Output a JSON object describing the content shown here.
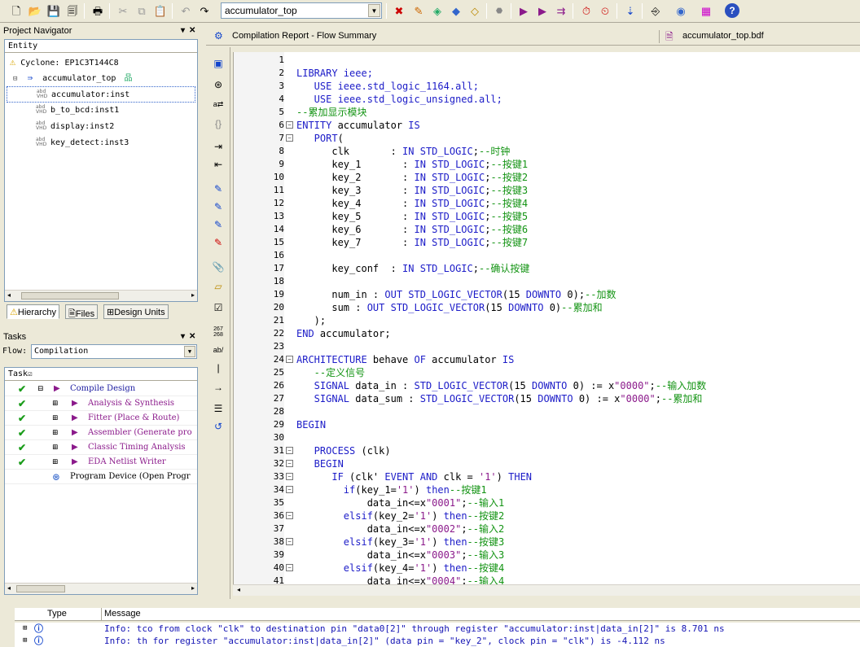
{
  "toolbar": {
    "project_combo": "accumulator_top"
  },
  "project_navigator": {
    "title": "Project Navigator",
    "column": "Entity",
    "device": "Cyclone: EP1C3T144C8",
    "top_entity": "accumulator_top",
    "instances": [
      "accumulator:inst",
      "b_to_bcd:inst1",
      "display:inst2",
      "key_detect:inst3"
    ],
    "tabs": [
      "Hierarchy",
      "Files",
      "Design Units"
    ]
  },
  "tasks": {
    "title": "Tasks",
    "flow_label": "Flow:",
    "flow_value": "Compilation",
    "column": "Task",
    "items": [
      "Compile Design",
      "Analysis & Synthesis",
      "Fitter (Place & Route)",
      "Assembler (Generate pro",
      "Classic Timing Analysis",
      "EDA Netlist Writer",
      "Program Device (Open Progr"
    ]
  },
  "editor_tabs": {
    "left": "Compilation Report - Flow Summary",
    "right": "accumulator_top.bdf"
  },
  "code_lines": [
    [
      [
        "",
        ""
      ]
    ],
    [
      [
        "kw",
        "LIBRARY ieee;"
      ]
    ],
    [
      [
        "kw",
        "   USE ieee.std_logic_1164.all;"
      ]
    ],
    [
      [
        "kw",
        "   USE ieee.std_logic_unsigned.all;"
      ]
    ],
    [
      [
        "cm",
        "--累加显示模块"
      ]
    ],
    [
      [
        "kw",
        "ENTITY"
      ],
      [
        "",
        "accumulator"
      ],
      [
        "kw",
        "IS"
      ]
    ],
    [
      [
        "kw",
        "   PORT"
      ],
      [
        "",
        "("
      ]
    ],
    [
      [
        "",
        "      clk       : "
      ],
      [
        "kw",
        "IN STD_LOGIC"
      ],
      [
        "",
        ";"
      ],
      [
        "cm",
        "--时钟"
      ]
    ],
    [
      [
        "",
        "      key_1       : "
      ],
      [
        "kw",
        "IN STD_LOGIC"
      ],
      [
        "",
        ";"
      ],
      [
        "cm",
        "--按键1"
      ]
    ],
    [
      [
        "",
        "      key_2       : "
      ],
      [
        "kw",
        "IN STD_LOGIC"
      ],
      [
        "",
        ";"
      ],
      [
        "cm",
        "--按键2"
      ]
    ],
    [
      [
        "",
        "      key_3       : "
      ],
      [
        "kw",
        "IN STD_LOGIC"
      ],
      [
        "",
        ";"
      ],
      [
        "cm",
        "--按键3"
      ]
    ],
    [
      [
        "",
        "      key_4       : "
      ],
      [
        "kw",
        "IN STD_LOGIC"
      ],
      [
        "",
        ";"
      ],
      [
        "cm",
        "--按键4"
      ]
    ],
    [
      [
        "",
        "      key_5       : "
      ],
      [
        "kw",
        "IN STD_LOGIC"
      ],
      [
        "",
        ";"
      ],
      [
        "cm",
        "--按键5"
      ]
    ],
    [
      [
        "",
        "      key_6       : "
      ],
      [
        "kw",
        "IN STD_LOGIC"
      ],
      [
        "",
        ";"
      ],
      [
        "cm",
        "--按键6"
      ]
    ],
    [
      [
        "",
        "      key_7       : "
      ],
      [
        "kw",
        "IN STD_LOGIC"
      ],
      [
        "",
        ";"
      ],
      [
        "cm",
        "--按键7"
      ]
    ],
    [
      [
        "",
        ""
      ]
    ],
    [
      [
        "",
        "      key_conf  : "
      ],
      [
        "kw",
        "IN STD_LOGIC"
      ],
      [
        "",
        ";"
      ],
      [
        "cm",
        "--确认按键"
      ]
    ],
    [
      [
        "",
        ""
      ]
    ],
    [
      [
        "",
        "      num_in : "
      ],
      [
        "kw",
        "OUT STD_LOGIC_VECTOR"
      ],
      [
        "",
        "(15 "
      ],
      [
        "kw",
        "DOWNTO"
      ],
      [
        "",
        " 0);"
      ],
      [
        "cm",
        "--加数"
      ]
    ],
    [
      [
        "",
        "      sum : "
      ],
      [
        "kw",
        "OUT STD_LOGIC_VECTOR"
      ],
      [
        "",
        "(15 "
      ],
      [
        "kw",
        "DOWNTO"
      ],
      [
        "",
        " 0)"
      ],
      [
        "cm",
        "--累加和"
      ]
    ],
    [
      [
        "",
        "   );"
      ]
    ],
    [
      [
        "kw",
        "END"
      ],
      [
        "",
        " accumulator;"
      ]
    ],
    [
      [
        "",
        ""
      ]
    ],
    [
      [
        "kw",
        "ARCHITECTURE"
      ],
      [
        "",
        " behave "
      ],
      [
        "kw",
        "OF"
      ],
      [
        "",
        " accumulator "
      ],
      [
        "kw",
        "IS"
      ]
    ],
    [
      [
        "cm",
        "   --定义信号"
      ]
    ],
    [
      [
        "kw",
        "   SIGNAL"
      ],
      [
        "",
        " data_in : "
      ],
      [
        "kw",
        "STD_LOGIC_VECTOR"
      ],
      [
        "",
        "(15 "
      ],
      [
        "kw",
        "DOWNTO"
      ],
      [
        "",
        " 0) := x"
      ],
      [
        "st",
        "\"0000\""
      ],
      [
        "",
        ";"
      ],
      [
        "cm",
        "--输入加数"
      ]
    ],
    [
      [
        "kw",
        "   SIGNAL"
      ],
      [
        "",
        " data_sum : "
      ],
      [
        "kw",
        "STD_LOGIC_VECTOR"
      ],
      [
        "",
        "(15 "
      ],
      [
        "kw",
        "DOWNTO"
      ],
      [
        "",
        " 0) := x"
      ],
      [
        "st",
        "\"0000\""
      ],
      [
        "",
        ";"
      ],
      [
        "cm",
        "--累加和"
      ]
    ],
    [
      [
        "",
        ""
      ]
    ],
    [
      [
        "kw",
        "BEGIN"
      ]
    ],
    [
      [
        "",
        ""
      ]
    ],
    [
      [
        "kw",
        "   PROCESS"
      ],
      [
        "",
        " (clk)"
      ]
    ],
    [
      [
        "kw",
        "   BEGIN"
      ]
    ],
    [
      [
        "kw",
        "      IF"
      ],
      [
        "",
        " (clk'"
      ],
      [
        "kw",
        "EVENT AND"
      ],
      [
        "",
        " clk = "
      ],
      [
        "st",
        "'1'"
      ],
      [
        "",
        ") "
      ],
      [
        "kw",
        "THEN"
      ]
    ],
    [
      [
        "kw",
        "        if"
      ],
      [
        "",
        "(key_1="
      ],
      [
        "st",
        "'1'"
      ],
      [
        "",
        ")"
      ],
      [
        "kw",
        "then"
      ],
      [
        "cm",
        "--按键1"
      ]
    ],
    [
      [
        "",
        "            data_in<=x"
      ],
      [
        "st",
        "\"0001\""
      ],
      [
        "",
        ";"
      ],
      [
        "cm",
        "--输入1"
      ]
    ],
    [
      [
        "kw",
        "        elsif"
      ],
      [
        "",
        "(key_2="
      ],
      [
        "st",
        "'1'"
      ],
      [
        "",
        ")"
      ],
      [
        "kw",
        "then"
      ],
      [
        "cm",
        "--按键2"
      ]
    ],
    [
      [
        "",
        "            data_in<=x"
      ],
      [
        "st",
        "\"0002\""
      ],
      [
        "",
        ";"
      ],
      [
        "cm",
        "--输入2"
      ]
    ],
    [
      [
        "kw",
        "        elsif"
      ],
      [
        "",
        "(key_3="
      ],
      [
        "st",
        "'1'"
      ],
      [
        "",
        ")"
      ],
      [
        "kw",
        "then"
      ],
      [
        "cm",
        "--按键3"
      ]
    ],
    [
      [
        "",
        "            data_in<=x"
      ],
      [
        "st",
        "\"0003\""
      ],
      [
        "",
        ";"
      ],
      [
        "cm",
        "--输入3"
      ]
    ],
    [
      [
        "kw",
        "        elsif"
      ],
      [
        "",
        "(key_4="
      ],
      [
        "st",
        "'1'"
      ],
      [
        "",
        ")"
      ],
      [
        "kw",
        "then"
      ],
      [
        "cm",
        "--按键4"
      ]
    ],
    [
      [
        "",
        "            data_in<=x"
      ],
      [
        "st",
        "\"0004\""
      ],
      [
        "",
        ";"
      ],
      [
        "cm",
        "--输入4"
      ]
    ]
  ],
  "messages": {
    "col_type": "Type",
    "col_message": "Message",
    "rows": [
      "Info: tco from clock \"clk\" to destination pin \"data0[2]\" through register \"accumulator:inst|data_in[2]\" is 8.701 ns",
      "Info: th for register \"accumulator:inst|data_in[2]\" (data pin = \"key_2\", clock pin = \"clk\") is -4.112 ns"
    ]
  }
}
